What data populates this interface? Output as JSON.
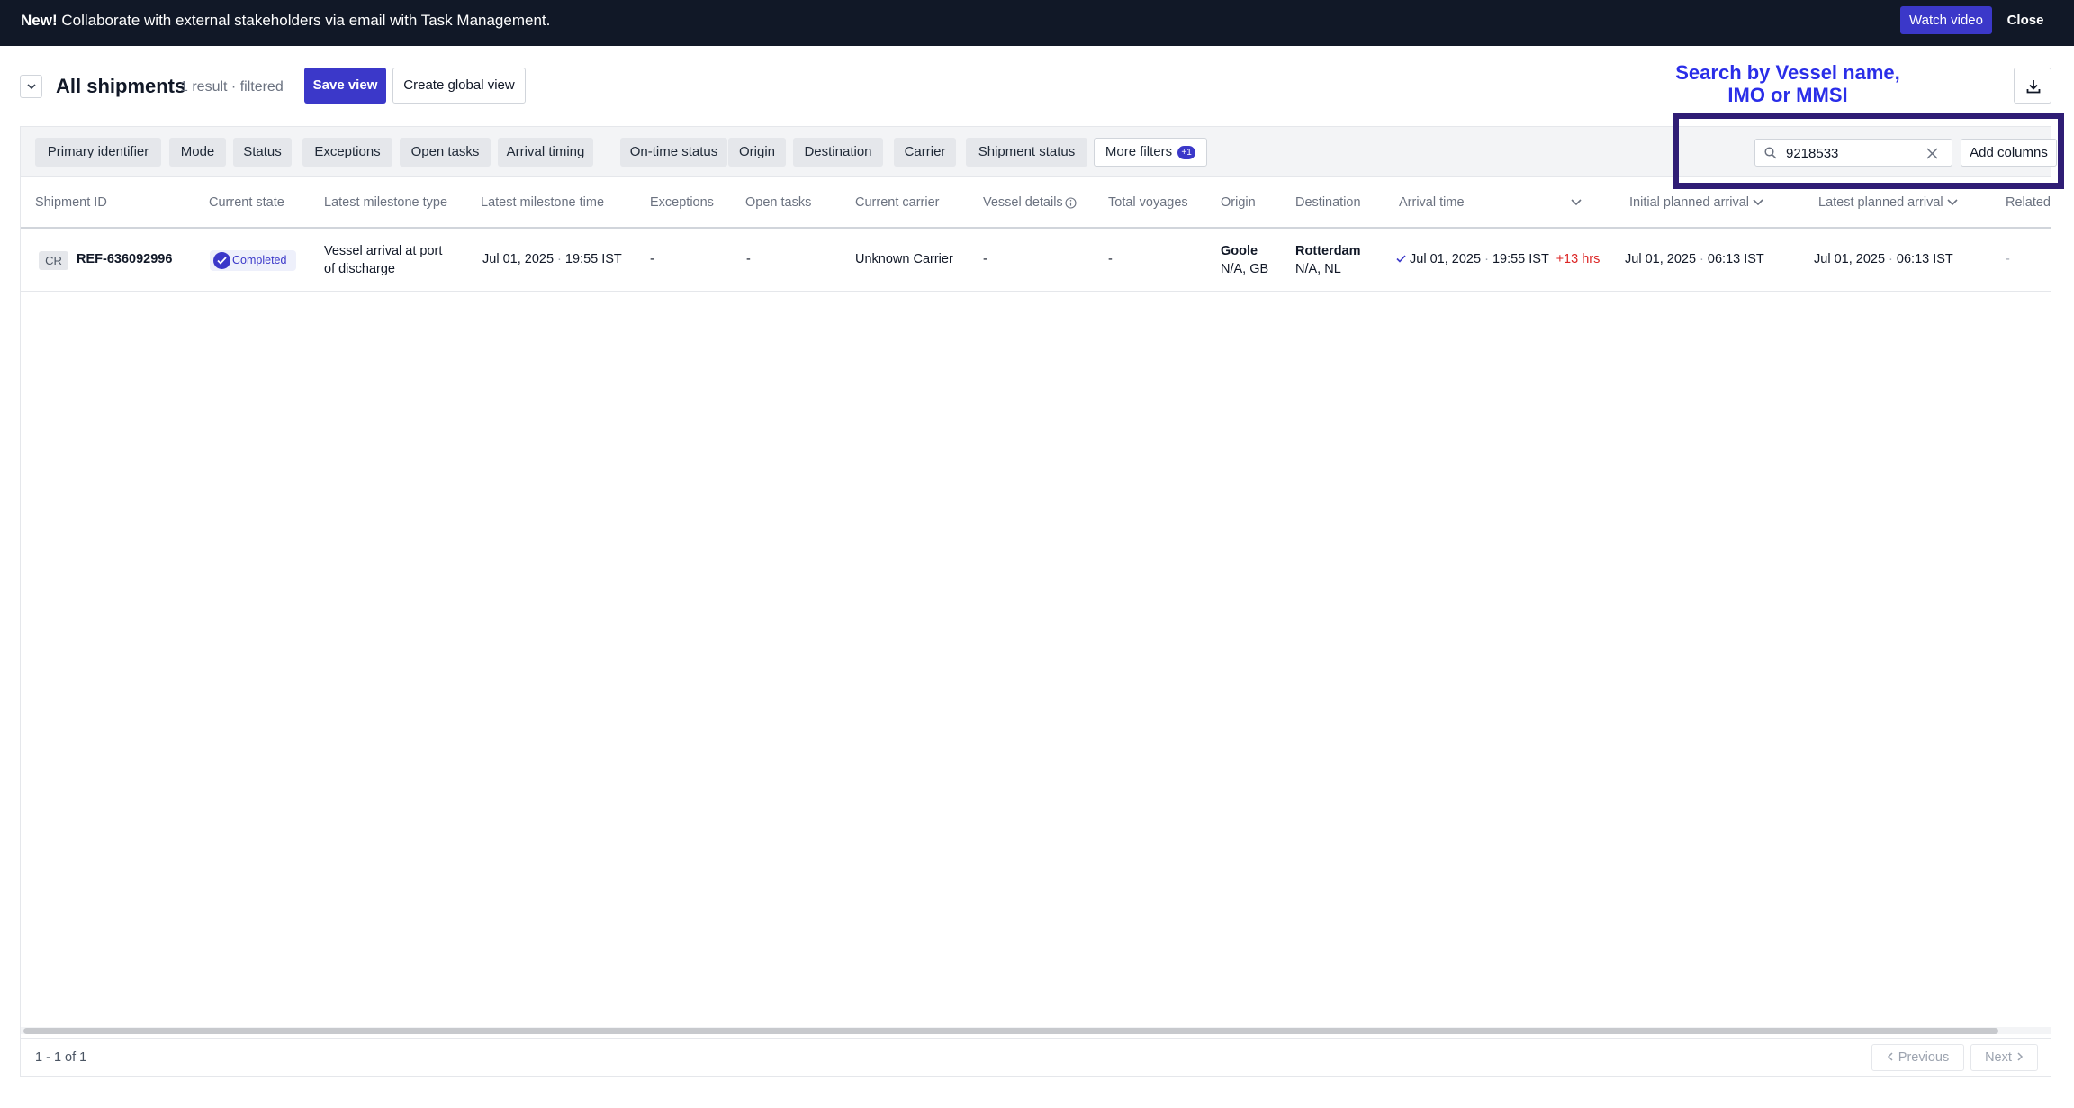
{
  "banner": {
    "new_label": "New!",
    "message": " Collaborate with external stakeholders via email with Task Management.",
    "watch_video": "Watch video",
    "close": "Close"
  },
  "header": {
    "title": "All shipments",
    "result_count": "1 result",
    "filtered": "· filtered",
    "save_view": "Save view",
    "create_global_view": "Create global view",
    "download_icon": "download-icon"
  },
  "annotation": {
    "line1": "Search by Vessel name,",
    "line2": "IMO or MMSI"
  },
  "filters": {
    "chips": [
      "Primary identifier",
      "Mode",
      "Status",
      "Exceptions",
      "Open tasks",
      "Arrival timing",
      "On-time status",
      "Origin",
      "Destination",
      "Carrier",
      "Shipment status"
    ],
    "more_filters": "More filters",
    "more_filters_badge": "+1"
  },
  "search": {
    "value": "9218533",
    "add_columns": "Add columns"
  },
  "table": {
    "columns": [
      "Shipment ID",
      "Current state",
      "Latest milestone type",
      "Latest milestone time",
      "Exceptions",
      "Open tasks",
      "Current carrier",
      "Vessel details",
      "Total voyages",
      "Origin",
      "Destination",
      "Arrival time",
      "Initial planned arrival",
      "Latest planned arrival",
      "Related"
    ],
    "rows": [
      {
        "tag": "CR",
        "shipment_id": "REF-636092996",
        "current_state": "Completed",
        "milestone_type_line1": "Vessel arrival at port",
        "milestone_type_line2": "of discharge",
        "milestone_time_date": "Jul 01, 2025",
        "milestone_time_time": "19:55 IST",
        "exceptions": "-",
        "open_tasks": "-",
        "current_carrier": "Unknown Carrier",
        "vessel_details": "-",
        "total_voyages": "-",
        "origin_city": "Goole",
        "origin_region": "N/A, GB",
        "destination_city": "Rotterdam",
        "destination_region": "N/A, NL",
        "arrival_date": "Jul 01, 2025",
        "arrival_time": "19:55 IST",
        "arrival_delay": "+13 hrs",
        "initial_date": "Jul 01, 2025",
        "initial_time": "06:13 IST",
        "latest_date": "Jul 01, 2025",
        "latest_time": "06:13 IST",
        "related": "-"
      }
    ]
  },
  "pagination": {
    "range": "1 - 1 of 1",
    "previous": "Previous",
    "next": "Next"
  },
  "colors": {
    "primary": "#3b38c9",
    "banner_bg": "#111827",
    "annotation": "#2a2ee8",
    "annotation_border": "#2f1d75",
    "delay": "#dc2626"
  }
}
